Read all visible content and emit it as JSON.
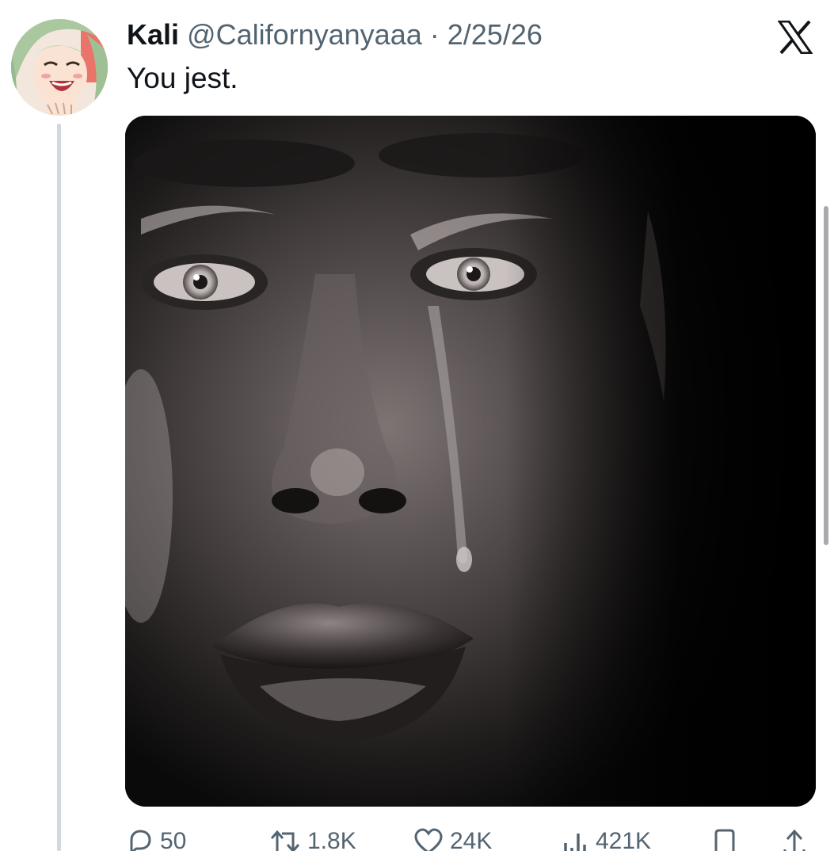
{
  "tweet": {
    "display_name": "Kali",
    "handle": "@Californyanyaaa",
    "separator": "·",
    "date": "2/25/26",
    "text": "You jest."
  },
  "icons": {
    "brand": "x-logo-icon",
    "reply": "reply-icon",
    "repost": "repost-icon",
    "like": "heart-icon",
    "views": "views-chart-icon",
    "bookmark": "bookmark-icon",
    "share": "share-icon"
  },
  "actions": {
    "replies": "50",
    "reposts": "1.8K",
    "likes": "24K",
    "views": "421K"
  },
  "colors": {
    "text_primary": "#0f1419",
    "text_secondary": "#536471",
    "thread_line": "#cfd9de",
    "avatar_hair": "#a9c8a0",
    "avatar_bg": "#e9746a"
  }
}
